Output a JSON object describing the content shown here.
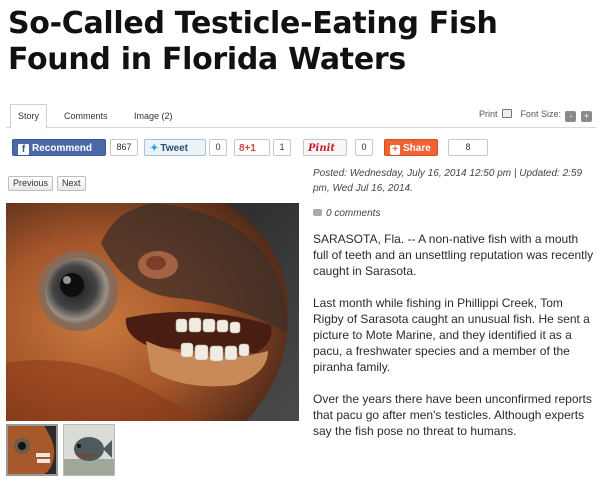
{
  "headline": "So-Called Testicle-Eating Fish Found in Florida Waters",
  "tabs": {
    "story": "Story",
    "comments": "Comments",
    "image": "Image (2)"
  },
  "tools": {
    "print": "Print",
    "font_size": "Font Size:",
    "minus": "-",
    "plus": "+"
  },
  "social": {
    "facebook_label": "Recommend",
    "facebook_count": "867",
    "twitter_label": "Tweet",
    "twitter_count": "0",
    "gplus_label": "8+1",
    "gplus_count": "1",
    "pin_label": "Pinit",
    "pin_count": "0",
    "share_label": "Share",
    "share_count": "8"
  },
  "pager": {
    "previous": "Previous",
    "next": "Next"
  },
  "meta": {
    "posted": "Posted: Wednesday, July 16, 2014 12:50 pm | Updated: 2:59 pm, Wed Jul 16, 2014.",
    "comments": "0 comments"
  },
  "article": {
    "p1": "SARASOTA, Fla. -- A non-native fish with a mouth full of teeth and an unsettling reputation was recently caught in Sarasota.",
    "p2": "Last month while fishing in Phillippi Creek, Tom Rigby of Sarasota caught an unusual fish. He sent a picture to Mote Marine, and they identified it as a pacu, a freshwater species and a member of the piranha family.",
    "p3": "Over the years there have been unconfirmed reports that pacu go after men's testicles. Although experts say the fish pose no threat to humans."
  },
  "colors": {
    "facebook": "#4a67a6",
    "share": "#ef6233",
    "gplus": "#d14836",
    "pinterest": "#cb2027"
  }
}
